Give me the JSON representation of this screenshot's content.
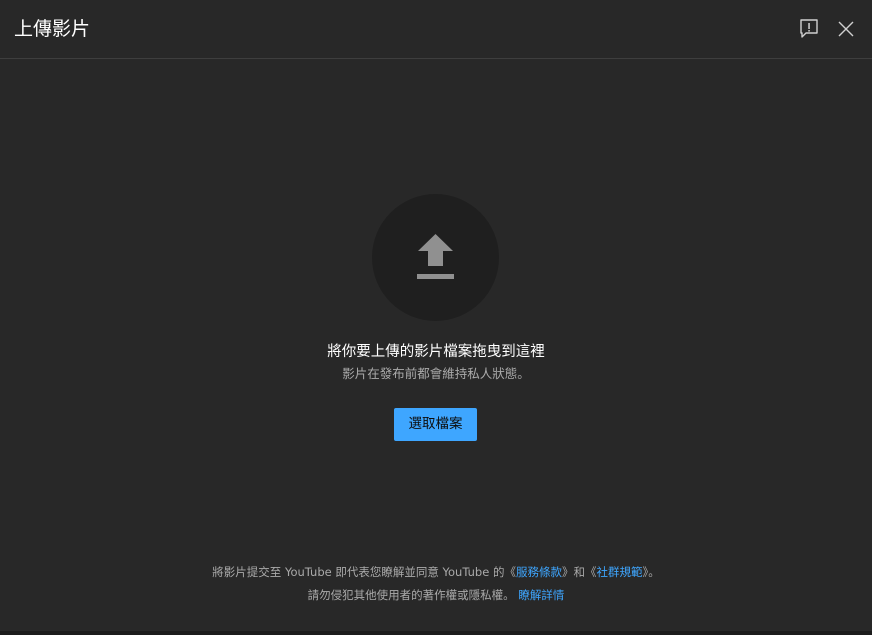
{
  "header": {
    "title": "上傳影片",
    "feedback_icon": "feedback-icon",
    "close_icon": "close-icon"
  },
  "main": {
    "upload_icon": "upload-arrow-icon",
    "drop_title": "將你要上傳的影片檔案拖曳到這裡",
    "drop_subtitle": "影片在發布前都會維持私人狀態。",
    "select_button": "選取檔案"
  },
  "footer": {
    "line1_prefix": "將影片提交至 YouTube 即代表您瞭解並同意 YouTube 的《",
    "terms_link": "服務條款",
    "line1_middle": "》和《",
    "guidelines_link": "社群規範",
    "line1_suffix": "》。",
    "line2_text": "請勿侵犯其他使用者的著作權或隱私權。",
    "learn_more_link": "瞭解詳情"
  },
  "colors": {
    "background": "#282828",
    "accent": "#3ea6ff",
    "circle": "#1f1f1f",
    "secondary_text": "#aaaaaa"
  }
}
